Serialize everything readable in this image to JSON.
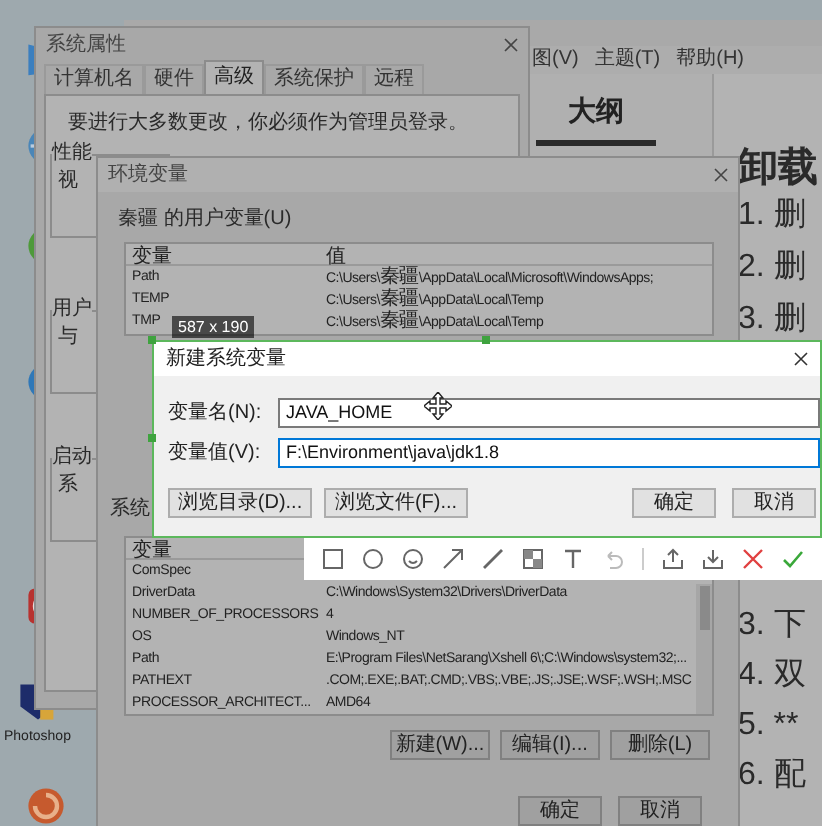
{
  "desktop": {
    "icons": [
      {
        "kind": "flag"
      },
      {
        "kind": "globe"
      },
      {
        "kind": "ball"
      },
      {
        "kind": "bird"
      },
      {
        "kind": "ring"
      },
      {
        "kind": "ps",
        "label": "Photoshop"
      },
      {
        "kind": "swirl"
      }
    ]
  },
  "editor_window": {
    "menu": [
      "图(V)",
      "主题(T)",
      "帮助(H)"
    ],
    "sidebar_tab": "大纲",
    "heading": "卸载",
    "list_top": [
      "1. 删",
      "2. 删",
      "3. 删"
    ],
    "list_bottom": [
      "3. 下",
      "4. 双",
      "5. **",
      "6. 配"
    ]
  },
  "system_properties": {
    "title": "系统属性",
    "tabs": [
      {
        "label": "计算机名",
        "selected": false
      },
      {
        "label": "硬件",
        "selected": false
      },
      {
        "label": "高级",
        "selected": true
      },
      {
        "label": "系统保护",
        "selected": false
      },
      {
        "label": "远程",
        "selected": false
      }
    ],
    "notice": "要进行大多数更改，你必须作为管理员登录。",
    "groups": [
      {
        "title": "性能",
        "text": "视"
      },
      {
        "title": "用户",
        "text": "与"
      },
      {
        "title": "启动",
        "text": "系"
      }
    ]
  },
  "environment_variables": {
    "title": "环境变量",
    "user_label": "秦疆 的用户变量(U)",
    "user_table": {
      "columns": [
        "变量",
        "值"
      ],
      "rows": [
        {
          "name": "Path",
          "value": "C:\\Users\\秦疆\\AppData\\Local\\Microsoft\\WindowsApps;"
        },
        {
          "name": "TEMP",
          "value": "C:\\Users\\秦疆\\AppData\\Local\\Temp"
        },
        {
          "name": "TMP",
          "value": "C:\\Users\\秦疆\\AppData\\Local\\Temp"
        }
      ]
    },
    "system_label": "系统",
    "system_table": {
      "columns": [
        "变量"
      ],
      "rows": [
        {
          "name": "ComSpec"
        },
        {
          "name": "DriverData",
          "value": "C:\\Windows\\System32\\Drivers\\DriverData"
        },
        {
          "name": "NUMBER_OF_PROCESSORS",
          "value": "4"
        },
        {
          "name": "OS",
          "value": "Windows_NT"
        },
        {
          "name": "Path",
          "value": "E:\\Program Files\\NetSarang\\Xshell 6\\;C:\\Windows\\system32;..."
        },
        {
          "name": "PATHEXT",
          "value": ".COM;.EXE;.BAT;.CMD;.VBS;.VBE;.JS;.JSE;.WSF;.WSH;.MSC"
        },
        {
          "name": "PROCESSOR_ARCHITECT...",
          "value": "AMD64"
        }
      ]
    },
    "table_buttons": [
      "新建(W)...",
      "编辑(I)...",
      "删除(L)"
    ],
    "buttons": [
      "确定",
      "取消"
    ]
  },
  "capture_size": "587 x 190",
  "new_variable_dialog": {
    "title": "新建系统变量",
    "name_label": "变量名(N):",
    "name_value": "JAVA_HOME",
    "value_label": "变量值(V):",
    "value_value": "F:\\Environment\\java\\jdk1.8",
    "browse_buttons": [
      "浏览目录(D)...",
      "浏览文件(F)..."
    ],
    "buttons": [
      "确定",
      "取消"
    ]
  }
}
